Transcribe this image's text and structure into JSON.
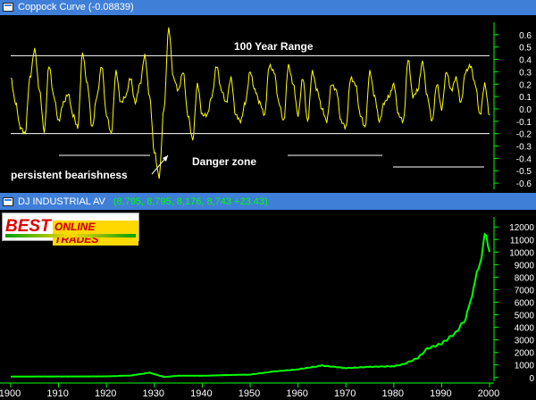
{
  "top_pane": {
    "title": "Coppock Curve (-0.08839)",
    "annotations": {
      "range": "100 Year Range",
      "danger": "Danger zone",
      "bearish": "persistent bearishness"
    }
  },
  "bottom_pane": {
    "title": "DJ INDUSTRIAL AV",
    "values": "(8,795, 8,795, 8,176, 8,743 +23.43)"
  },
  "logo": {
    "word1": "BEST",
    "word2": "ONLINE TRADES"
  },
  "colors": {
    "coppock": "#ffff00",
    "dow": "#00ff00",
    "axis": "#00ff00",
    "title_bar": "#3f7fd8",
    "range_lines": "#ffffff"
  },
  "chart_data": [
    {
      "type": "line",
      "name": "Coppock Curve",
      "ylim": [
        -0.65,
        0.7
      ],
      "yticks": [
        "0.6",
        "0.5",
        "0.4",
        "0.3",
        "0.2",
        "0.1",
        "0.0",
        "-0.1",
        "-0.2",
        "-0.3",
        "-0.4",
        "-0.5",
        "-0.6"
      ],
      "reference_lines": [
        0.43,
        -0.2
      ],
      "x": [
        1900,
        1901,
        1902,
        1903,
        1904,
        1905,
        1906,
        1907,
        1908,
        1909,
        1910,
        1911,
        1912,
        1913,
        1914,
        1915,
        1916,
        1917,
        1918,
        1919,
        1920,
        1921,
        1922,
        1923,
        1924,
        1925,
        1926,
        1927,
        1928,
        1929,
        1930,
        1931,
        1932,
        1933,
        1934,
        1935,
        1936,
        1937,
        1938,
        1939,
        1940,
        1941,
        1942,
        1943,
        1944,
        1945,
        1946,
        1947,
        1948,
        1949,
        1950,
        1951,
        1952,
        1953,
        1954,
        1955,
        1956,
        1957,
        1958,
        1959,
        1960,
        1961,
        1962,
        1963,
        1964,
        1965,
        1966,
        1967,
        1968,
        1969,
        1970,
        1971,
        1972,
        1973,
        1974,
        1975,
        1976,
        1977,
        1978,
        1979,
        1980,
        1981,
        1982,
        1983,
        1984,
        1985,
        1986,
        1987,
        1988,
        1989,
        1990,
        1991,
        1992,
        1993,
        1994,
        1995,
        1996,
        1997,
        1998,
        1999,
        2000
      ],
      "values": [
        0.25,
        0.05,
        -0.15,
        -0.2,
        0.25,
        0.48,
        0.15,
        -0.18,
        0.35,
        0.1,
        -0.1,
        0.05,
        0.12,
        -0.05,
        -0.15,
        0.45,
        0.2,
        -0.15,
        0.1,
        0.35,
        -0.05,
        -0.2,
        0.3,
        0.05,
        0.1,
        0.25,
        0.05,
        0.2,
        0.43,
        0.1,
        -0.35,
        -0.55,
        0.0,
        0.65,
        0.25,
        0.15,
        0.3,
        -0.05,
        -0.25,
        0.2,
        -0.05,
        -0.05,
        0.1,
        0.35,
        0.15,
        0.05,
        0.25,
        -0.05,
        -0.1,
        0.05,
        0.3,
        0.15,
        0.05,
        -0.05,
        0.35,
        0.3,
        0.05,
        -0.1,
        0.35,
        0.2,
        -0.05,
        0.25,
        -0.1,
        0.3,
        0.15,
        0.0,
        -0.1,
        0.2,
        0.15,
        -0.1,
        -0.15,
        0.25,
        0.2,
        -0.05,
        -0.15,
        0.3,
        0.1,
        -0.1,
        0.05,
        0.1,
        0.2,
        -0.05,
        -0.1,
        0.4,
        0.1,
        0.15,
        0.38,
        0.1,
        -0.1,
        0.2,
        0.0,
        0.3,
        0.15,
        0.25,
        0.05,
        0.3,
        0.35,
        0.2,
        -0.05,
        0.2,
        -0.05
      ]
    },
    {
      "type": "line",
      "name": "DJ INDUSTRIAL AV",
      "ylim": [
        -300,
        12800
      ],
      "yticks": [
        "12000",
        "11000",
        "10000",
        "9000",
        "8000",
        "7000",
        "6000",
        "5000",
        "4000",
        "3000",
        "2000",
        "1000",
        "0"
      ],
      "xticks": [
        "1900",
        "1910",
        "1920",
        "1930",
        "1940",
        "1950",
        "1960",
        "1970",
        "1980",
        "1990",
        "2000"
      ],
      "x": [
        1900,
        1905,
        1910,
        1915,
        1920,
        1925,
        1929,
        1932,
        1935,
        1940,
        1945,
        1950,
        1955,
        1960,
        1965,
        1970,
        1975,
        1980,
        1982,
        1985,
        1987,
        1990,
        1993,
        1995,
        1996,
        1997,
        1998,
        1999,
        2000
      ],
      "values": [
        66,
        80,
        81,
        85,
        90,
        160,
        381,
        42,
        140,
        140,
        190,
        230,
        480,
        650,
        950,
        750,
        850,
        900,
        1050,
        1550,
        2300,
        2700,
        3600,
        4700,
        6000,
        7800,
        9000,
        11500,
        10000
      ]
    }
  ]
}
